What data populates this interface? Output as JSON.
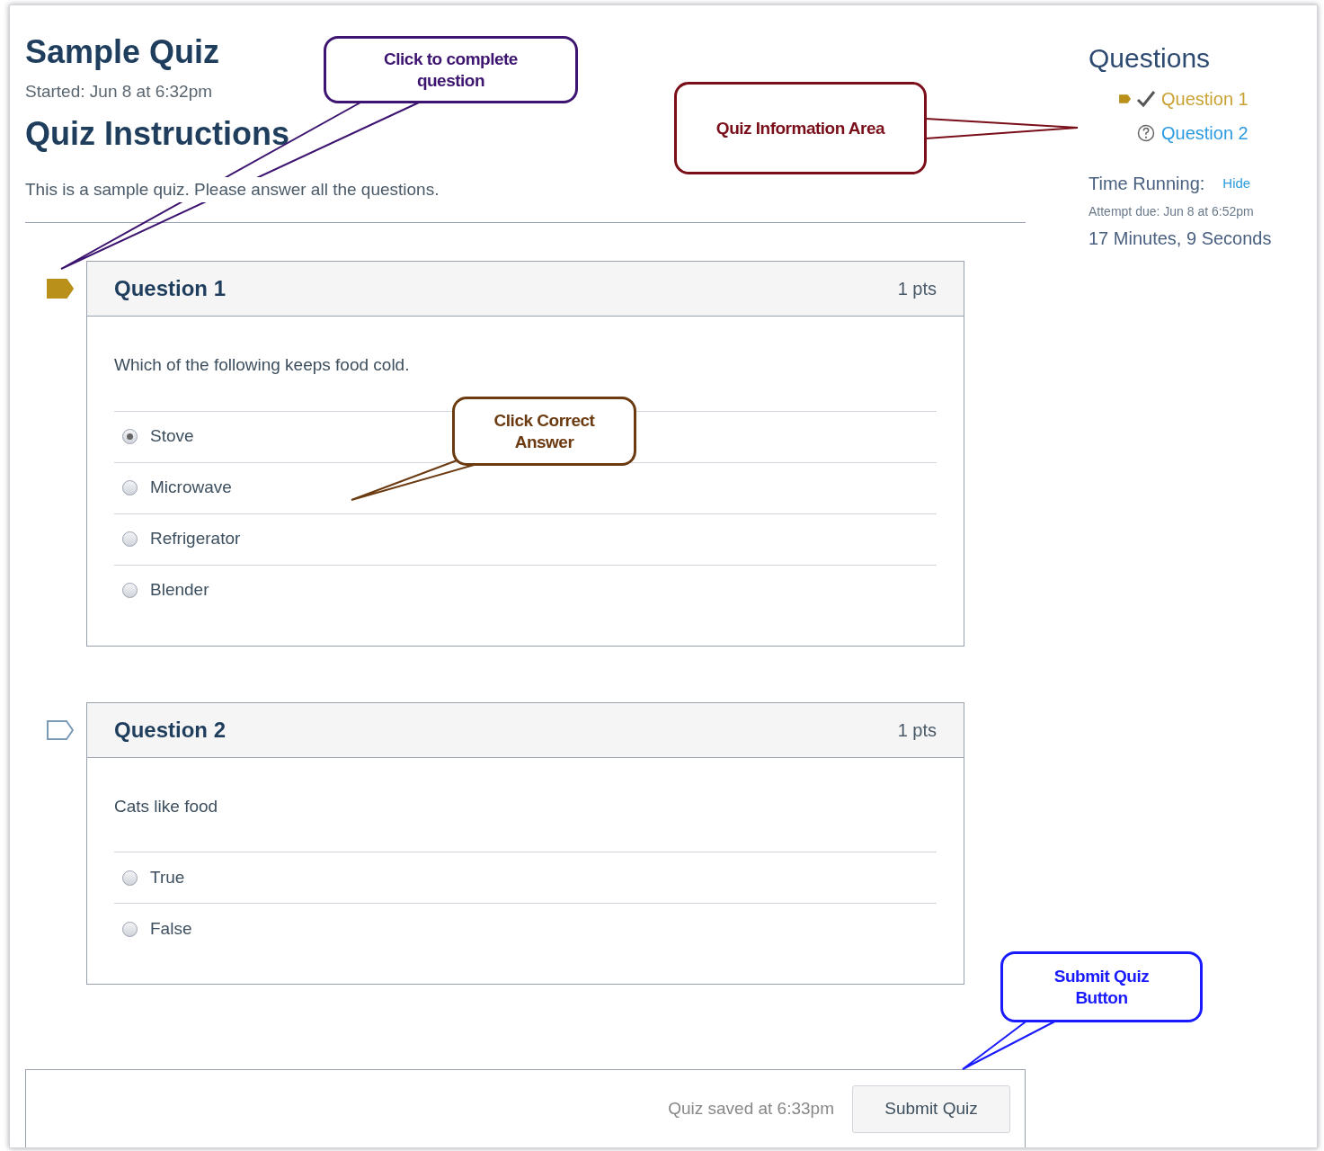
{
  "quiz": {
    "title": "Sample Quiz",
    "started": "Started: Jun 8 at 6:32pm",
    "instructions_heading": "Quiz Instructions",
    "instructions": "This is a sample quiz. Please answer all the questions."
  },
  "questions": [
    {
      "title": "Question 1",
      "points": "1 pts",
      "flagged": true,
      "prompt": "Which of the following keeps food cold.",
      "answers": [
        {
          "label": "Stove",
          "selected": true
        },
        {
          "label": "Microwave",
          "selected": false
        },
        {
          "label": "Refrigerator",
          "selected": false
        },
        {
          "label": "Blender",
          "selected": false
        }
      ]
    },
    {
      "title": "Question 2",
      "points": "1 pts",
      "flagged": false,
      "prompt": "Cats like food",
      "answers": [
        {
          "label": "True",
          "selected": false
        },
        {
          "label": "False",
          "selected": false
        }
      ]
    }
  ],
  "footer": {
    "saved": "Quiz saved at 6:33pm",
    "submit": "Submit Quiz"
  },
  "sidebar": {
    "heading": "Questions",
    "items": [
      {
        "label": "Question 1",
        "flagged": true,
        "answered": true
      },
      {
        "label": "Question 2",
        "flagged": false,
        "answered": false
      }
    ],
    "time_label": "Time Running:",
    "hide": "Hide",
    "attempt_due": "Attempt due: Jun 8 at 6:52pm",
    "elapsed": "17 Minutes, 9 Seconds"
  },
  "callouts": [
    {
      "text": "Click to complete question",
      "color": "#3d1470"
    },
    {
      "text": "Quiz Information Area",
      "color": "#7a0f1a"
    },
    {
      "text": "Click Correct Answer",
      "color": "#6b3a10"
    },
    {
      "text": "Submit Quiz Button",
      "color": "#1a1aff"
    }
  ]
}
